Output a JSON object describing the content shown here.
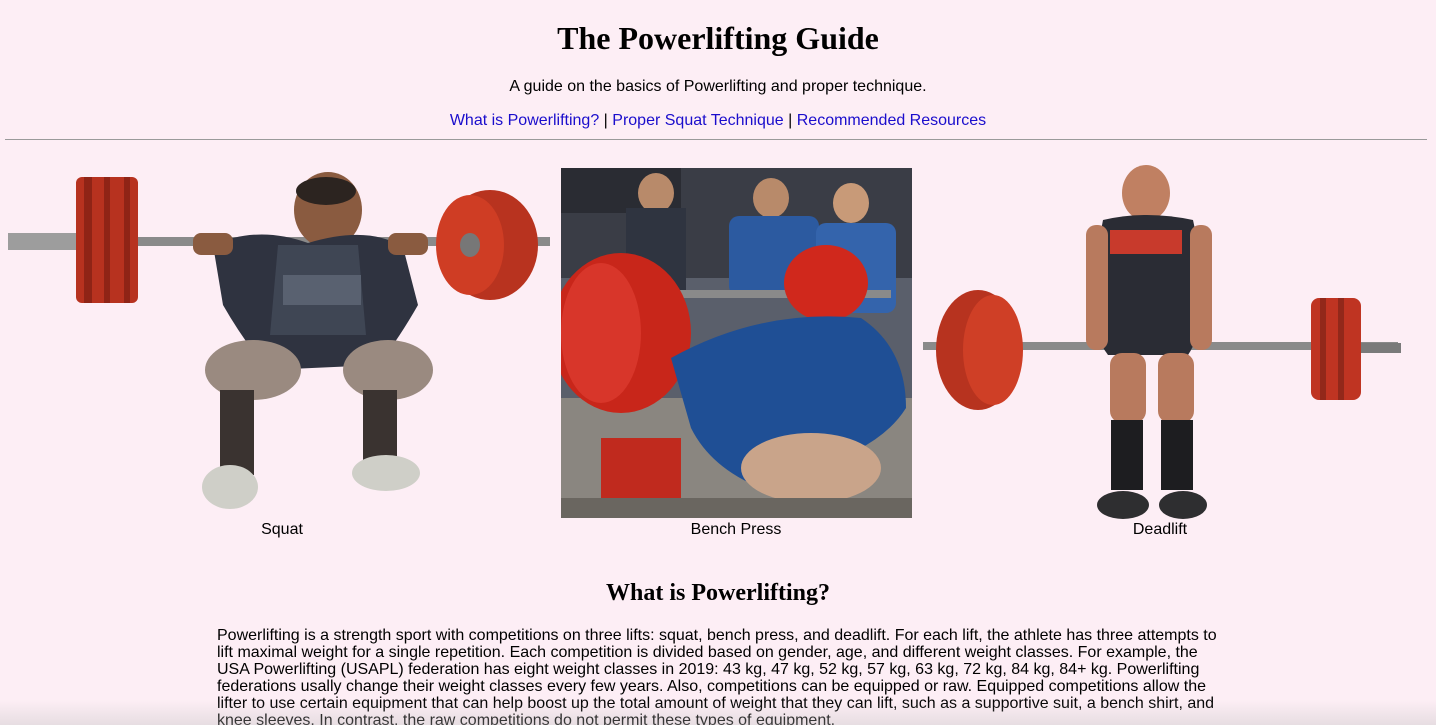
{
  "header": {
    "title": "The Powerlifting Guide",
    "tagline": "A guide on the basics of Powerlifting and proper technique."
  },
  "nav": {
    "links": [
      "What is Powerlifting?",
      "Proper Squat Technique",
      "Recommended Resources"
    ],
    "separator": "|"
  },
  "lifts": [
    {
      "caption": "Squat",
      "icon": "squat-photo"
    },
    {
      "caption": "Bench Press",
      "icon": "bench-press-photo"
    },
    {
      "caption": "Deadlift",
      "icon": "deadlift-photo"
    }
  ],
  "section": {
    "heading": "What is Powerlifting?",
    "paragraph": "Powerlifting is a strength sport with competitions on three lifts: squat, bench press, and deadlift. For each lift, the athlete has three attempts to lift maximal weight for a single repetition. Each competition is divided based on gender, age, and different weight classes. For example, the USA Powerlifting (USAPL) federation has eight weight classes in 2019: 43 kg, 47 kg, 52 kg, 57 kg, 63 kg, 72 kg, 84 kg, 84+ kg. Powerlifting federations usally change their weight classes every few years. Also, competitions can be equipped or raw. Equipped competitions allow the lifter to use certain equipment that can help boost up the total amount of weight that they can lift, such as a supportive suit, a bench shirt, and knee sleeves. In contrast, the raw competitions do not permit these types of equipment."
  },
  "colors": {
    "background": "#fdeef5",
    "link": "#1a0dcc",
    "plate_red": "#c0301e",
    "divider": "#9a9a9a"
  }
}
